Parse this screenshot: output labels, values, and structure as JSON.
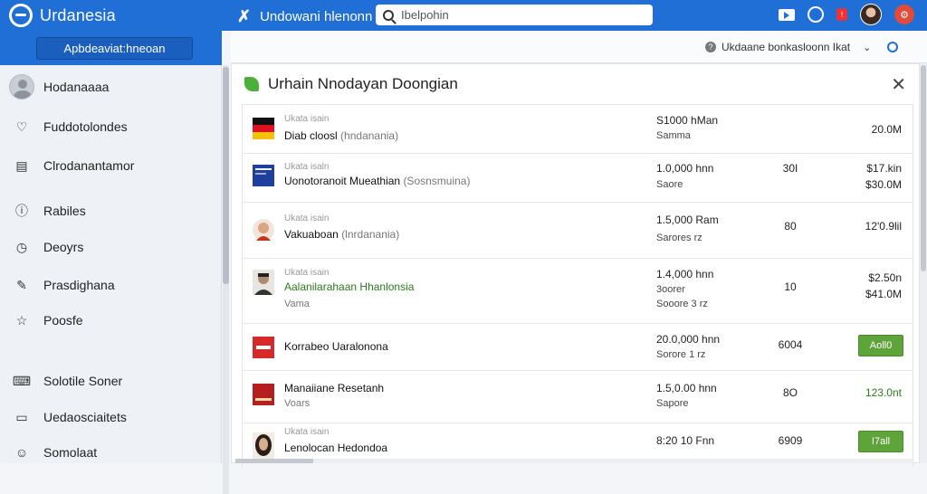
{
  "topbar": {
    "brand": "Urdanesia",
    "app_title": "Undowani hlenonn",
    "search_value": "Ibelpohin",
    "icons": [
      "video-icon",
      "globe-icon",
      "notification-badge",
      "user-avatar",
      "red-circle-icon"
    ],
    "badge_text": "!",
    "colors": {
      "accent": "#1f6fd6",
      "alert": "#e24b3b"
    }
  },
  "sidebar": {
    "primary_button": "Apbdeaviat:hneoan",
    "profile_name": "Hodanaaaa",
    "items": [
      {
        "icon": "heart-icon",
        "label": "Fuddotolondes"
      },
      {
        "icon": "table-icon",
        "label": "Clrodanantamor"
      },
      {
        "icon": "info-icon",
        "label": "Rabiles"
      },
      {
        "icon": "clock-icon",
        "label": "Deoyrs"
      },
      {
        "icon": "edit-icon",
        "label": "Prasdighana"
      },
      {
        "icon": "star-icon",
        "label": "Poosfe"
      },
      {
        "icon": "keyboard-icon",
        "label": "Solotile Soner"
      },
      {
        "icon": "folder-icon",
        "label": "Uedaosciaitets"
      },
      {
        "icon": "user-icon",
        "label": "Somolaat"
      }
    ]
  },
  "main": {
    "help_text": "Ukdaane bonkasloonn Ikat",
    "panel_title": "Urhain Nnodayan Doongian",
    "rows": [
      {
        "category": "Ukata isain",
        "name": "Diab cloosl",
        "name_sub": "(hndanania)",
        "sub": "",
        "price1": "S1000 hMan",
        "price2": "Samma",
        "qty": "",
        "amt1": "20.0M",
        "amt2": "",
        "button": ""
      },
      {
        "category": "Ukata isaln",
        "name": "Uonotoranoit Mueathian",
        "name_sub": "(Sosnsmuina)",
        "sub": "",
        "price1": "1.0,000 hnn",
        "price2": "Saore",
        "qty": "30I",
        "amt1": "$17.kin",
        "amt2": "$30.0M",
        "button": ""
      },
      {
        "category": "Ukata isain",
        "name": "Vakuaboan",
        "name_sub": "(lnrdanania)",
        "sub": "",
        "price1": "1.5,000 Ram",
        "price2": "Sarores  rz",
        "qty": "80",
        "amt1": "12'0.9lil",
        "amt2": "",
        "button": ""
      },
      {
        "category": "Ukata isain",
        "name": "Aalanilarahaan Hhanlonsia",
        "name_sub": "",
        "sub": "Vama",
        "price1": "1.4,000 hnn",
        "price2": "3oorer",
        "price3": "Sooore 3  rz",
        "qty": "10",
        "amt1": "$2.50n",
        "amt2": "$41.0M",
        "button": ""
      },
      {
        "category": "",
        "name": "Korrabeo Uaralonona",
        "name_sub": "",
        "sub": "",
        "price1": "20.0,000 hnn",
        "price2": "Sorore 1  rz",
        "qty": "6004",
        "amt1": "",
        "amt2": "",
        "button": "Aoll0"
      },
      {
        "category": "",
        "name": "Manaiiane Resetanh",
        "name_sub": "",
        "sub": "Voars",
        "price1": "1.5,0.00 hnn",
        "price2": "Sapore",
        "qty": "8O",
        "amt1": "123.0nt",
        "amt2": "",
        "button": ""
      },
      {
        "category": "Ukata isain",
        "name": "Lenolocan Hedondoa",
        "name_sub": "",
        "sub": "",
        "price1": "8:20 10 Fnn",
        "price2": "",
        "qty": "6909",
        "amt1": "",
        "amt2": "",
        "button": "I7all"
      }
    ]
  }
}
